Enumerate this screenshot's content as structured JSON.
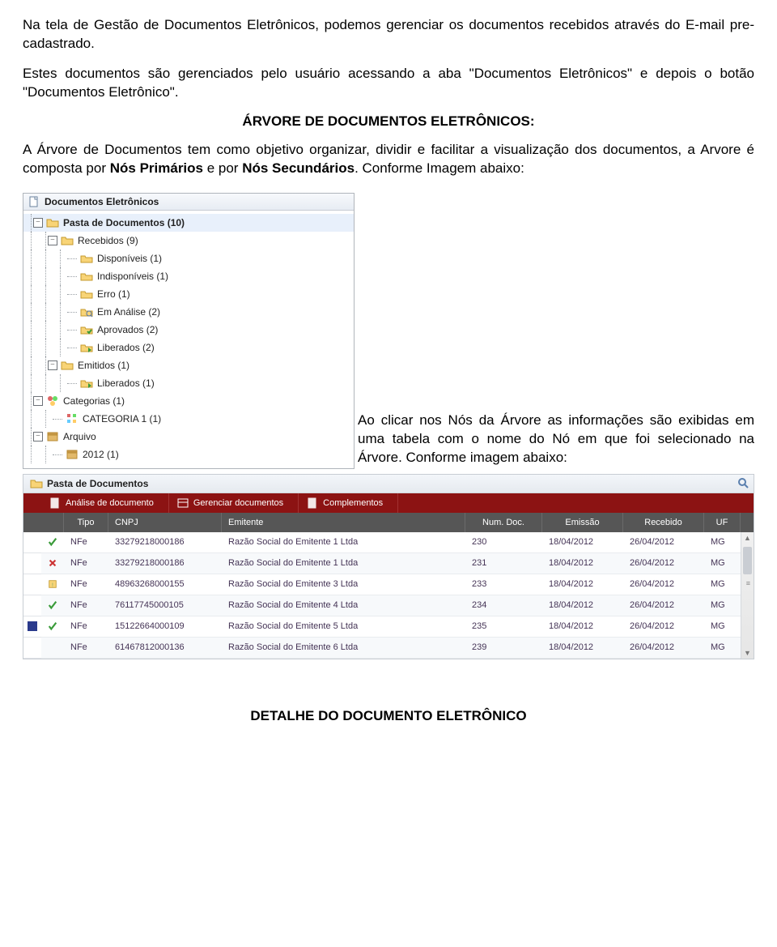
{
  "paragraphs": {
    "p1": "Na tela de Gestão de Documentos Eletrônicos, podemos gerenciar os documentos recebidos  através do E-mail pre-cadastrado.",
    "p2": "Estes documentos são gerenciados pelo usuário acessando a aba \"Documentos Eletrônicos\" e depois o botão \"Documentos Eletrônico\".",
    "section1": "ÁRVORE DE DOCUMENTOS ELETRÔNICOS:",
    "p3a": "A Árvore de Documentos tem como objetivo organizar, dividir e facilitar a visualização dos documentos, a Arvore é composta por ",
    "p3b": "Nós Primários",
    "p3c": " e por ",
    "p3d": "Nós Secundários",
    "p3e": ". Conforme Imagem abaixo:",
    "caption1": "Ao clicar nos Nós da Árvore as informações são exibidas em uma tabela com o nome do Nó em que foi selecionado na Árvore. Conforme imagem abaixo:",
    "footer": "DETALHE DO DOCUMENTO ELETRÔNICO"
  },
  "tree": {
    "title": "Documentos Eletrônicos",
    "nodes": {
      "root": "Pasta de Documentos (10)",
      "recebidos": "Recebidos (9)",
      "disponiveis": "Disponíveis (1)",
      "indisponiveis": "Indisponíveis (1)",
      "erro": "Erro (1)",
      "analise": "Em Análise (2)",
      "aprovados": "Aprovados (2)",
      "liberados": "Liberados (2)",
      "emitidos": "Emitidos (1)",
      "liberados2": "Liberados (1)",
      "categorias": "Categorias (1)",
      "cat1": "CATEGORIA 1 (1)",
      "arquivo": "Arquivo",
      "a2012": "2012 (1)"
    }
  },
  "table": {
    "title": "Pasta de Documentos",
    "toolbar": {
      "analise": "Análise de documento",
      "gerenciar": "Gerenciar documentos",
      "complementos": "Complementos"
    },
    "headers": {
      "tipo": "Tipo",
      "cnpj": "CNPJ",
      "emitente": "Emitente",
      "num": "Num. Doc.",
      "emissao": "Emissão",
      "recebido": "Recebido",
      "uf": "UF"
    },
    "rows": [
      {
        "status": "ok",
        "tipo": "NFe",
        "cnpj": "33279218000186",
        "emitente": "Razão Social do Emitente 1 Ltda",
        "num": "230",
        "emissao": "18/04/2012",
        "recebido": "26/04/2012",
        "uf": "MG"
      },
      {
        "status": "err",
        "tipo": "NFe",
        "cnpj": "33279218000186",
        "emitente": "Razão Social do Emitente 1 Ltda",
        "num": "231",
        "emissao": "18/04/2012",
        "recebido": "26/04/2012",
        "uf": "MG"
      },
      {
        "status": "warn",
        "tipo": "NFe",
        "cnpj": "48963268000155",
        "emitente": "Razão Social do Emitente 3 Ltda",
        "num": "233",
        "emissao": "18/04/2012",
        "recebido": "26/04/2012",
        "uf": "MG"
      },
      {
        "status": "ok",
        "tipo": "NFe",
        "cnpj": "76117745000105",
        "emitente": "Razão Social do Emitente 4 Ltda",
        "num": "234",
        "emissao": "18/04/2012",
        "recebido": "26/04/2012",
        "uf": "MG"
      },
      {
        "status": "ok",
        "tipo": "NFe",
        "cnpj": "15122664000109",
        "emitente": "Razão Social do Emitente 5 Ltda",
        "num": "235",
        "emissao": "18/04/2012",
        "recebido": "26/04/2012",
        "uf": "MG",
        "sel": true
      },
      {
        "status": "none",
        "tipo": "NFe",
        "cnpj": "61467812000136",
        "emitente": "Razão Social do Emitente 6 Ltda",
        "num": "239",
        "emissao": "18/04/2012",
        "recebido": "26/04/2012",
        "uf": "MG"
      }
    ]
  }
}
